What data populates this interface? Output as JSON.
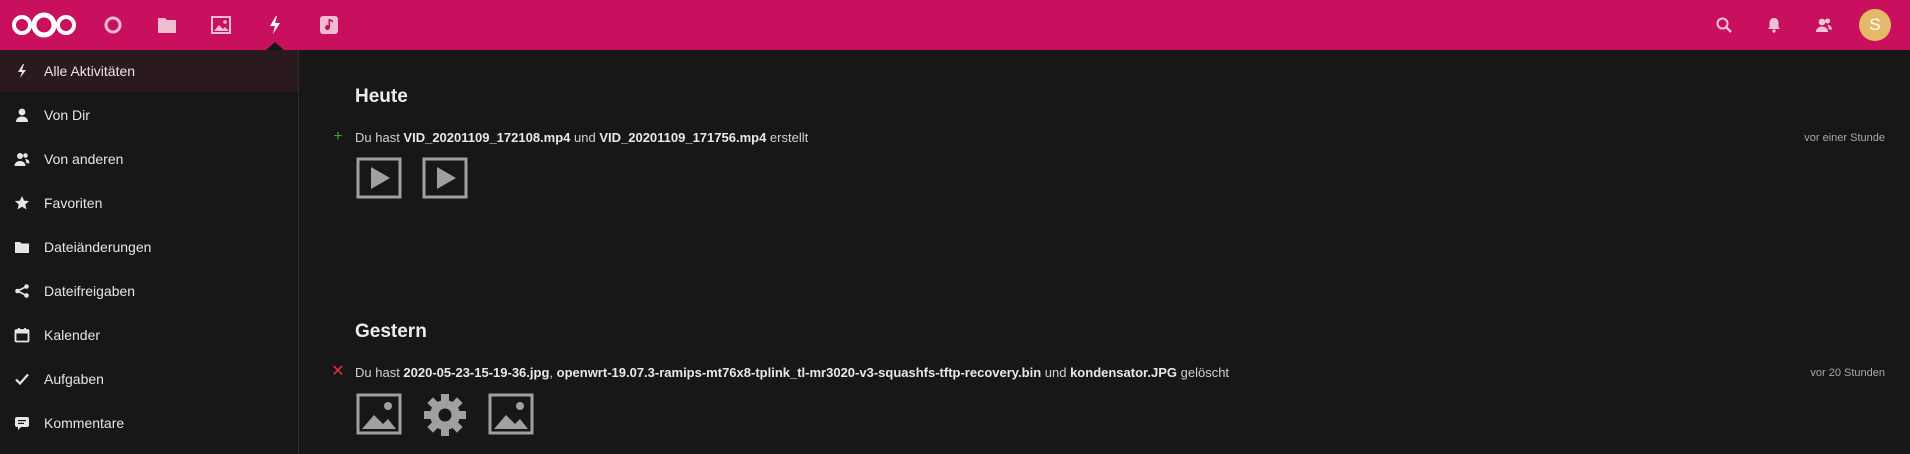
{
  "header": {
    "apps": [
      {
        "icon": "dashboard-icon"
      },
      {
        "icon": "files-folder-icon"
      },
      {
        "icon": "photos-icon"
      },
      {
        "icon": "activity-lightning-icon",
        "active": true
      },
      {
        "icon": "music-icon"
      }
    ],
    "right_icons": [
      "search-icon",
      "bell-icon",
      "contacts-icon"
    ],
    "avatar_initial": "S",
    "brand_color": "#c9105e",
    "avatar_color": "#e4b96a"
  },
  "sidebar": {
    "items": [
      {
        "label": "Alle Aktivitäten",
        "icon": "lightning-icon",
        "active": true
      },
      {
        "label": "Von Dir",
        "icon": "user-icon"
      },
      {
        "label": "Von anderen",
        "icon": "users-icon"
      },
      {
        "label": "Favoriten",
        "icon": "star-icon"
      },
      {
        "label": "Dateiänderungen",
        "icon": "folder-icon"
      },
      {
        "label": "Dateifreigaben",
        "icon": "share-icon"
      },
      {
        "label": "Kalender",
        "icon": "calendar-icon"
      },
      {
        "label": "Aufgaben",
        "icon": "checkmark-icon"
      },
      {
        "label": "Kommentare",
        "icon": "comment-icon"
      }
    ]
  },
  "main": {
    "sections": [
      {
        "title": "Heute",
        "activity": {
          "type_icon": "add-icon",
          "type_color": "#2ea836",
          "parts": [
            "Du hast ",
            "VID_20201109_172108.mp4",
            " und ",
            "VID_20201109_171756.mp4",
            " erstellt"
          ],
          "time": "vor einer Stunde",
          "previews": [
            "video-icon",
            "video-icon"
          ]
        }
      },
      {
        "title": "Gestern",
        "activity": {
          "type_icon": "delete-icon",
          "type_color": "#e9322d",
          "parts": [
            "Du hast ",
            "2020-05-23-15-19-36.jpg",
            ", ",
            "openwrt-19.07.3-ramips-mt76x8-tplink_tl-mr3020-v3-squashfs-tftp-recovery.bin",
            " und ",
            "kondensator.JPG",
            " gelöscht"
          ],
          "time": "vor 20 Stunden",
          "previews": [
            "image-icon",
            "gear-icon",
            "image-icon"
          ]
        }
      }
    ]
  }
}
